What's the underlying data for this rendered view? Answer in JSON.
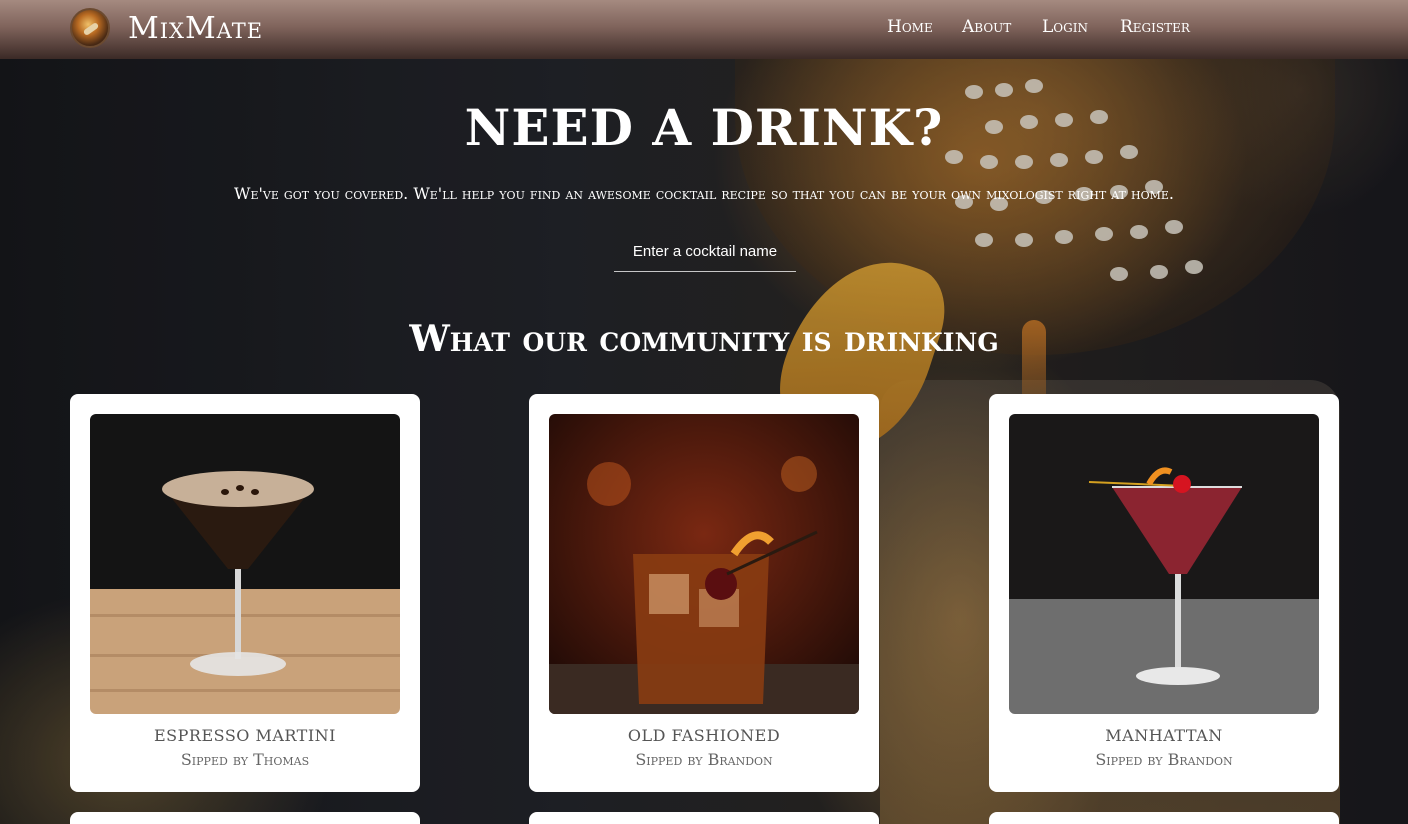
{
  "navbar": {
    "brand": "MixMate",
    "links": [
      {
        "label": "Home"
      },
      {
        "label": "About"
      },
      {
        "label": "Login"
      },
      {
        "label": "Register"
      }
    ]
  },
  "hero": {
    "title": "NEED A DRINK?",
    "subtitle": "We've got you covered. We'll help you find an awesome cocktail recipe so that you can be your own mixologist right at home.",
    "search_placeholder": "Enter a cocktail name"
  },
  "community": {
    "title": "What our community is drinking",
    "cards": [
      {
        "name": "ESPRESSO MARTINI",
        "by": "Sipped by Thomas"
      },
      {
        "name": "OLD FASHIONED",
        "by": "Sipped by Brandon"
      },
      {
        "name": "MANHATTAN",
        "by": "Sipped by Brandon"
      }
    ]
  },
  "colors": {
    "navbar_top": "#a58a80",
    "navbar_bottom": "#3b2a26",
    "card_bg": "#ffffff",
    "card_text": "#555555"
  }
}
